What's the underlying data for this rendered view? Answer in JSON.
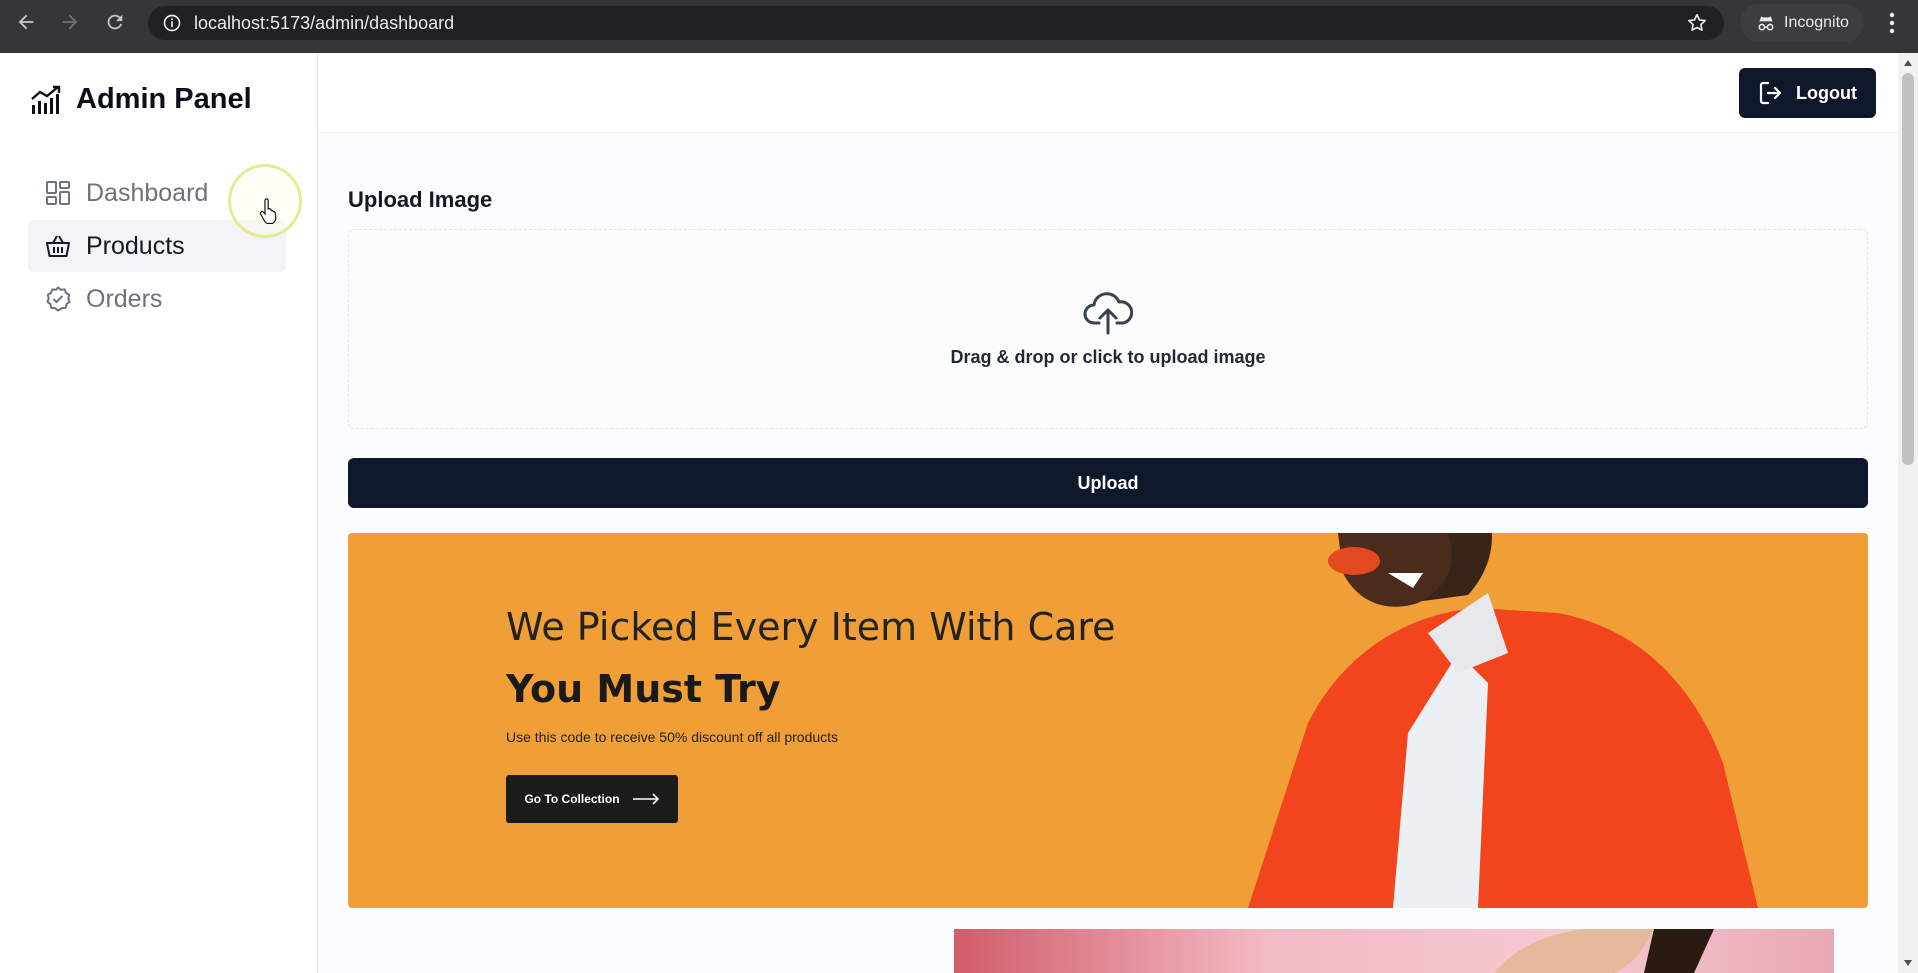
{
  "browser": {
    "url": "localhost:5173/admin/dashboard",
    "incognito_label": "Incognito",
    "icons": [
      "back-arrow-icon",
      "forward-arrow-icon",
      "reload-icon",
      "site-info-icon",
      "star-icon",
      "incognito-icon",
      "more-menu-icon"
    ]
  },
  "sidebar": {
    "brand": "Admin Panel",
    "items": [
      {
        "label": "Dashboard",
        "icon": "grid-icon",
        "active": false
      },
      {
        "label": "Products",
        "icon": "basket-icon",
        "active": true
      },
      {
        "label": "Orders",
        "icon": "check-badge-icon",
        "active": false
      }
    ]
  },
  "header": {
    "logout_label": "Logout"
  },
  "upload": {
    "title": "Upload Image",
    "dropzone_text": "Drag & drop or click to upload image",
    "button_label": "Upload"
  },
  "banner": {
    "headline": "We Picked Every Item With Care",
    "subheadline": "You Must Try",
    "description": "Use this code to receive 50% discount off all products",
    "button_label": "Go To Collection",
    "background_color": "#ef9f35"
  },
  "colors": {
    "primary": "#0f172a",
    "muted_text": "#6b7280",
    "active_bg": "#f3f4f6"
  }
}
